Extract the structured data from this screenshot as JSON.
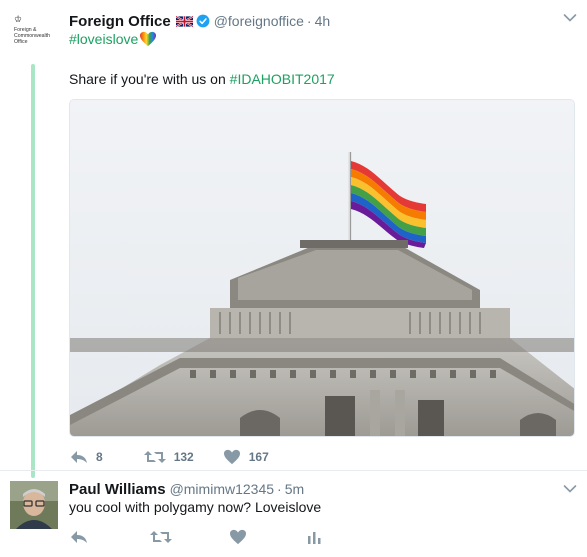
{
  "tweet": {
    "author": {
      "name": "Foreign Office",
      "handle": "@foreignoffice",
      "time": "4h",
      "avatar_text": [
        "Foreign &",
        "Commonwealth",
        "Office"
      ]
    },
    "hashtag_line": "#loveislove",
    "text_prefix": "Share if you're with us on ",
    "text_hashtag": "#IDAHOBIT2017",
    "image_description_icon": "rainbow-flag-on-building",
    "stats": {
      "replies": "8",
      "retweets": "132",
      "likes": "167"
    }
  },
  "reply": {
    "author": {
      "name": "Paul Williams",
      "handle": "@mimimw12345",
      "time": "5m"
    },
    "text": "you cool with polygamy now? Loveislove"
  },
  "separator": "·",
  "colors": {
    "hashtag": "#1da161",
    "thread_line": "#a8e6c6",
    "muted": "#657786",
    "verified": "#1da1f2"
  }
}
